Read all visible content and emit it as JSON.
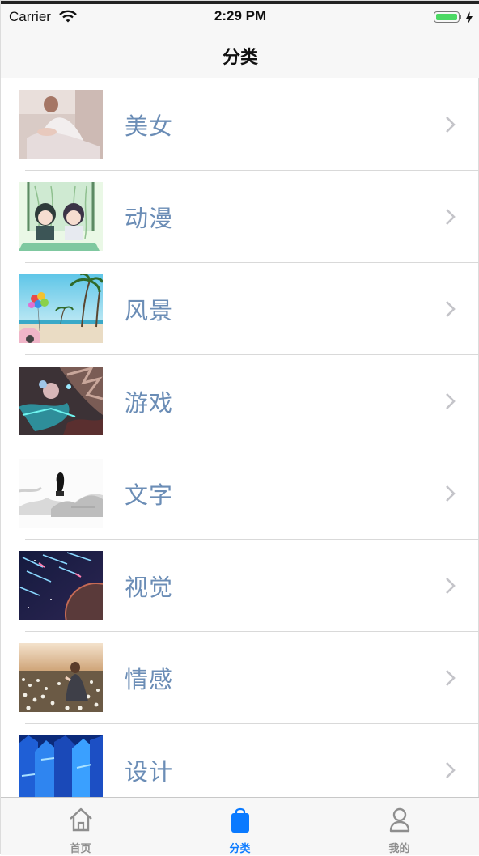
{
  "status_bar": {
    "carrier": "Carrier",
    "time": "2:29 PM"
  },
  "nav": {
    "title": "分类"
  },
  "categories": [
    {
      "label": "美女",
      "image": "portrait-photo"
    },
    {
      "label": "动漫",
      "image": "anime-illustration"
    },
    {
      "label": "风景",
      "image": "beach-palm-balloons"
    },
    {
      "label": "游戏",
      "image": "game-art"
    },
    {
      "label": "文字",
      "image": "ink-landscape"
    },
    {
      "label": "视觉",
      "image": "space-meteors"
    },
    {
      "label": "情感",
      "image": "girl-in-flower-field"
    },
    {
      "label": "设计",
      "image": "blue-prisms"
    }
  ],
  "tabs": [
    {
      "label": "首页",
      "icon": "home-icon",
      "active": false
    },
    {
      "label": "分类",
      "icon": "bag-icon",
      "active": true
    },
    {
      "label": "我的",
      "icon": "person-icon",
      "active": false
    }
  ],
  "colors": {
    "accent": "#0a7aff",
    "label_text": "#6b8db6",
    "battery": "#4cd964"
  }
}
